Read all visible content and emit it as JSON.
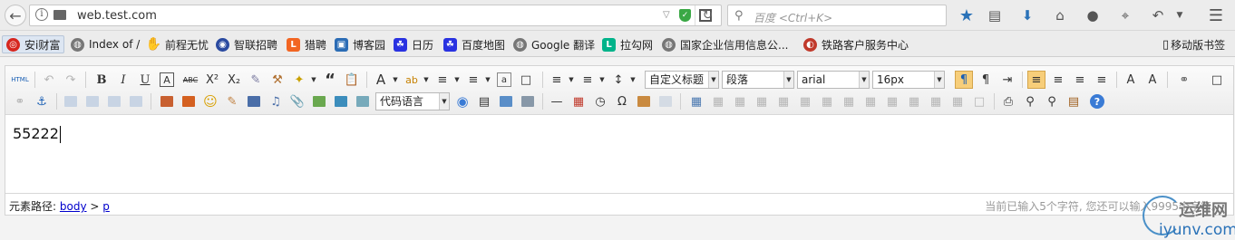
{
  "browser": {
    "url": "web.test.com",
    "search_placeholder": "百度 <Ctrl+K>",
    "info_glyph": "i"
  },
  "bookmarks": [
    {
      "label": "安i财富",
      "icon": "shield-icon",
      "color": "#d6261e"
    },
    {
      "label": "Index of /",
      "icon": "globe-icon",
      "color": "#777777"
    },
    {
      "label": "前程无忧",
      "icon": "hand-icon",
      "color": "#e08a00"
    },
    {
      "label": "智联招聘",
      "icon": "zhaopin-icon",
      "color": "#2a4aa0"
    },
    {
      "label": "猎聘",
      "icon": "liepin-icon",
      "color": "#f26522"
    },
    {
      "label": "博客园",
      "icon": "cnblogs-icon",
      "color": "#2b6cb5"
    },
    {
      "label": "日历",
      "icon": "baidu-icon",
      "color": "#2932e1"
    },
    {
      "label": "百度地图",
      "icon": "baidu-icon",
      "color": "#2932e1"
    },
    {
      "label": "Google 翻译",
      "icon": "globe-icon",
      "color": "#777777"
    },
    {
      "label": "拉勾网",
      "icon": "lagou-icon",
      "color": "#00b38a"
    },
    {
      "label": "国家企业信用信息公...",
      "icon": "globe-icon",
      "color": "#777777"
    },
    {
      "label": "铁路客户服务中心",
      "icon": "railway-icon",
      "color": "#c0392b"
    }
  ],
  "mobile_bookmarks": "移动版书签",
  "editor": {
    "heading_select": "自定义标题",
    "paragraph_select": "段落",
    "font_family_select": "arial",
    "font_size_select": "16px",
    "code_language_select": "代码语言",
    "content_text": "55222",
    "status_path_label": "元素路径:",
    "status_path_body": "body",
    "status_path_sep": ">",
    "status_path_p": "p",
    "word_count": "当前已输入5个字符, 您还可以输入9995个字符。"
  },
  "watermark": {
    "cn": "运维网",
    "en": "iyunv.com"
  },
  "colors": {
    "accent_blue": "#2a72b8",
    "active_button": "#f7ce7a"
  }
}
